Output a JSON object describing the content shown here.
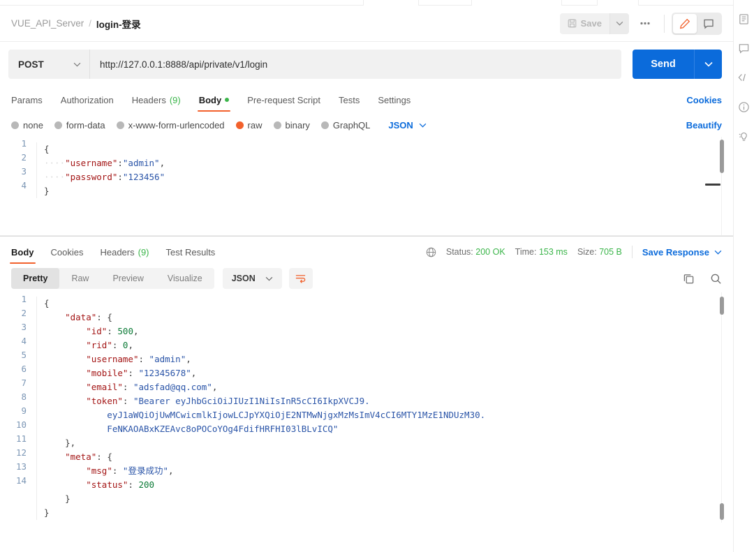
{
  "breadcrumb": {
    "collection": "VUE_API_Server",
    "separator": "/",
    "current": "login-登录"
  },
  "header": {
    "save_label": "Save",
    "more_label": "000",
    "save_icon": "floppy-disk-icon",
    "caret_icon": "chevron-down-icon",
    "edit_icon": "pencil-icon",
    "comment_icon": "comment-icon"
  },
  "request": {
    "method": "POST",
    "method_caret": "chevron-down-icon",
    "url": "http://127.0.0.1:8888/api/private/v1/login",
    "send_label": "Send",
    "send_caret": "chevron-down-icon"
  },
  "request_tabs": [
    {
      "label": "Params",
      "active": false
    },
    {
      "label": "Authorization",
      "active": false
    },
    {
      "label": "Headers",
      "count": "(9)",
      "active": false
    },
    {
      "label": "Body",
      "dot": true,
      "active": true
    },
    {
      "label": "Pre-request Script",
      "active": false
    },
    {
      "label": "Tests",
      "active": false
    },
    {
      "label": "Settings",
      "active": false
    }
  ],
  "cookies_link": "Cookies",
  "body_types": [
    {
      "label": "none",
      "selected": false
    },
    {
      "label": "form-data",
      "selected": false
    },
    {
      "label": "x-www-form-urlencoded",
      "selected": false
    },
    {
      "label": "raw",
      "selected": true
    },
    {
      "label": "binary",
      "selected": false
    },
    {
      "label": "GraphQL",
      "selected": false
    }
  ],
  "body_format": {
    "label": "JSON",
    "caret": "chevron-down-icon"
  },
  "beautify_label": "Beautify",
  "request_body": {
    "line_numbers": [
      "1",
      "2",
      "3",
      "4"
    ],
    "lines": [
      [
        {
          "t": "{",
          "c": "p"
        }
      ],
      [
        {
          "t": "····",
          "c": "ind"
        },
        {
          "t": "\"username\"",
          "c": "k"
        },
        {
          "t": ":",
          "c": "p"
        },
        {
          "t": "\"admin\"",
          "c": "s"
        },
        {
          "t": ",",
          "c": "p"
        }
      ],
      [
        {
          "t": "····",
          "c": "ind"
        },
        {
          "t": "\"password\"",
          "c": "k"
        },
        {
          "t": ":",
          "c": "p"
        },
        {
          "t": "\"123456\"",
          "c": "s"
        }
      ],
      [
        {
          "t": "}",
          "c": "p"
        }
      ]
    ]
  },
  "response_tabs": [
    {
      "label": "Body",
      "active": true
    },
    {
      "label": "Cookies",
      "active": false
    },
    {
      "label": "Headers",
      "count": "(9)",
      "active": false
    },
    {
      "label": "Test Results",
      "active": false
    }
  ],
  "response_status": {
    "globe_icon": "globe-icon",
    "status_label": "Status:",
    "status_value": "200 OK",
    "time_label": "Time:",
    "time_value": "153 ms",
    "size_label": "Size:",
    "size_value": "705 B",
    "save_response_label": "Save Response",
    "save_response_caret": "chevron-down-icon"
  },
  "response_formats": [
    {
      "label": "Pretty",
      "active": true
    },
    {
      "label": "Raw",
      "active": false
    },
    {
      "label": "Preview",
      "active": false
    },
    {
      "label": "Visualize",
      "active": false
    }
  ],
  "response_type": {
    "label": "JSON",
    "caret": "chevron-down-icon"
  },
  "response_icons": {
    "wrap_icon": "word-wrap-icon",
    "copy_icon": "copy-icon",
    "search_icon": "search-icon"
  },
  "response_body": {
    "line_numbers": [
      "1",
      "2",
      "3",
      "4",
      "5",
      "6",
      "7",
      "8",
      "",
      "",
      "9",
      "10",
      "11",
      "12",
      "13",
      "14"
    ],
    "lines": [
      [
        {
          "t": "{",
          "c": "p"
        }
      ],
      [
        {
          "t": "    ",
          "c": "p"
        },
        {
          "t": "\"data\"",
          "c": "k"
        },
        {
          "t": ": {",
          "c": "p"
        }
      ],
      [
        {
          "t": "        ",
          "c": "p"
        },
        {
          "t": "\"id\"",
          "c": "k"
        },
        {
          "t": ": ",
          "c": "p"
        },
        {
          "t": "500",
          "c": "n"
        },
        {
          "t": ",",
          "c": "p"
        }
      ],
      [
        {
          "t": "        ",
          "c": "p"
        },
        {
          "t": "\"rid\"",
          "c": "k"
        },
        {
          "t": ": ",
          "c": "p"
        },
        {
          "t": "0",
          "c": "n"
        },
        {
          "t": ",",
          "c": "p"
        }
      ],
      [
        {
          "t": "        ",
          "c": "p"
        },
        {
          "t": "\"username\"",
          "c": "k"
        },
        {
          "t": ": ",
          "c": "p"
        },
        {
          "t": "\"admin\"",
          "c": "s"
        },
        {
          "t": ",",
          "c": "p"
        }
      ],
      [
        {
          "t": "        ",
          "c": "p"
        },
        {
          "t": "\"mobile\"",
          "c": "k"
        },
        {
          "t": ": ",
          "c": "p"
        },
        {
          "t": "\"12345678\"",
          "c": "s"
        },
        {
          "t": ",",
          "c": "p"
        }
      ],
      [
        {
          "t": "        ",
          "c": "p"
        },
        {
          "t": "\"email\"",
          "c": "k"
        },
        {
          "t": ": ",
          "c": "p"
        },
        {
          "t": "\"adsfad@qq.com\"",
          "c": "s"
        },
        {
          "t": ",",
          "c": "p"
        }
      ],
      [
        {
          "t": "        ",
          "c": "p"
        },
        {
          "t": "\"token\"",
          "c": "k"
        },
        {
          "t": ": ",
          "c": "p"
        },
        {
          "t": "\"Bearer eyJhbGciOiJIUzI1NiIsInR5cCI6IkpXVCJ9.",
          "c": "s"
        }
      ],
      [
        {
          "t": "            eyJ1aWQiOjUwMCwicmlkIjowLCJpYXQiOjE2NTMwNjgxMzMsImV4cCI6MTY1MzE1NDUzM30.",
          "c": "s"
        }
      ],
      [
        {
          "t": "            FeNKAOABxKZEAvc8oPOCoYOg4FdifHRFHI03lBLvICQ\"",
          "c": "s"
        }
      ],
      [
        {
          "t": "    },",
          "c": "p"
        }
      ],
      [
        {
          "t": "    ",
          "c": "p"
        },
        {
          "t": "\"meta\"",
          "c": "k"
        },
        {
          "t": ": {",
          "c": "p"
        }
      ],
      [
        {
          "t": "        ",
          "c": "p"
        },
        {
          "t": "\"msg\"",
          "c": "k"
        },
        {
          "t": ": ",
          "c": "p"
        },
        {
          "t": "\"登录成功\"",
          "c": "s"
        },
        {
          "t": ",",
          "c": "p"
        }
      ],
      [
        {
          "t": "        ",
          "c": "p"
        },
        {
          "t": "\"status\"",
          "c": "k"
        },
        {
          "t": ": ",
          "c": "p"
        },
        {
          "t": "200",
          "c": "n"
        }
      ],
      [
        {
          "t": "    }",
          "c": "p"
        }
      ],
      [
        {
          "t": "}",
          "c": "p"
        }
      ]
    ]
  },
  "right_rail": [
    {
      "icon": "documentation-icon"
    },
    {
      "icon": "comment-icon"
    },
    {
      "icon": "code-icon",
      "glyph": "</>"
    },
    {
      "icon": "info-icon"
    },
    {
      "icon": "lightbulb-icon"
    }
  ]
}
